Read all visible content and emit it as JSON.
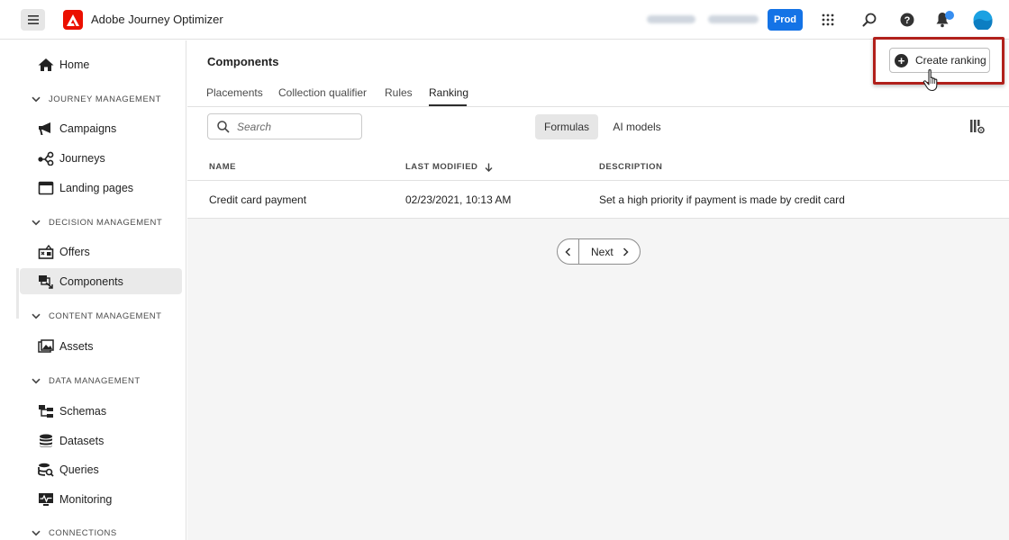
{
  "app": {
    "title": "Adobe Journey Optimizer",
    "env_button": "Prod"
  },
  "colors": {
    "accent": "#1473e6",
    "logo": "#eb1000",
    "highlight": "#b1201b"
  },
  "sidebar": {
    "items": [
      {
        "label": "Home",
        "icon": "home-icon"
      },
      {
        "label": "Campaigns",
        "icon": "megaphone-icon"
      },
      {
        "label": "Journeys",
        "icon": "journey-icon"
      },
      {
        "label": "Landing pages",
        "icon": "window-icon"
      },
      {
        "label": "Offers",
        "icon": "offer-icon"
      },
      {
        "label": "Components",
        "icon": "components-icon",
        "active": true
      },
      {
        "label": "Assets",
        "icon": "image-icon"
      },
      {
        "label": "Schemas",
        "icon": "schema-icon"
      },
      {
        "label": "Datasets",
        "icon": "database-icon"
      },
      {
        "label": "Queries",
        "icon": "query-icon"
      },
      {
        "label": "Monitoring",
        "icon": "monitor-icon"
      }
    ],
    "sections": [
      "JOURNEY MANAGEMENT",
      "DECISION MANAGEMENT",
      "CONTENT MANAGEMENT",
      "DATA MANAGEMENT",
      "CONNECTIONS"
    ]
  },
  "main": {
    "title": "Components",
    "tabs": [
      "Placements",
      "Collection qualifier",
      "Rules",
      "Ranking"
    ],
    "active_tab": "Ranking",
    "create_button": "Create ranking",
    "search": {
      "placeholder": "Search"
    },
    "segments": [
      "Formulas",
      "AI models"
    ],
    "table": {
      "headers": [
        "NAME",
        "LAST MODIFIED",
        "DESCRIPTION"
      ],
      "rows": [
        [
          "Credit card payment",
          "02/23/2021, 10:13 AM",
          "Set a high priority if payment is made by credit card"
        ]
      ]
    },
    "pager": {
      "next": "Next"
    }
  }
}
